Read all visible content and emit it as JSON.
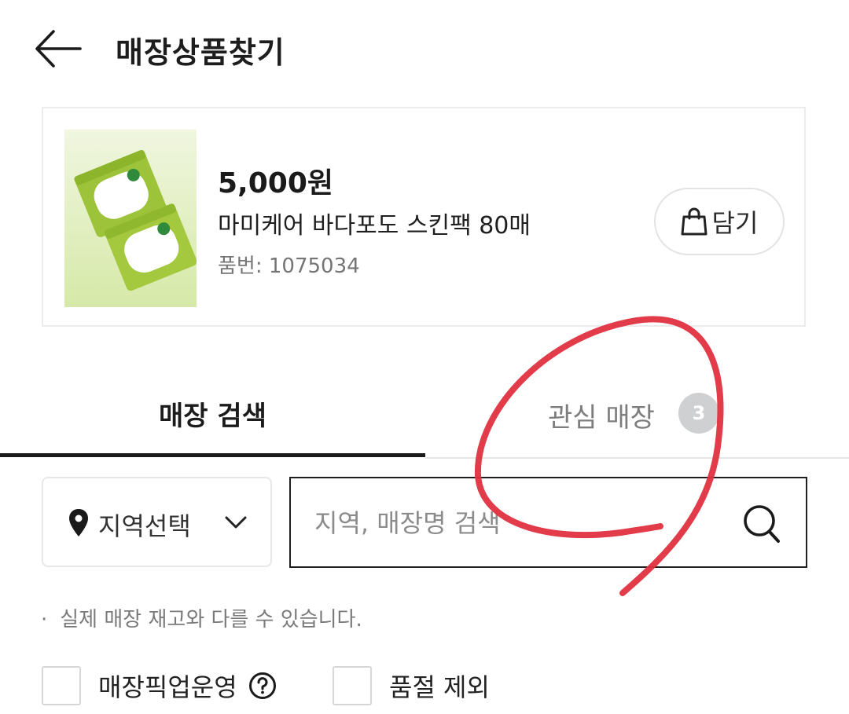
{
  "header": {
    "title": "매장상품찾기",
    "back_icon": "arrow-left-icon"
  },
  "product": {
    "price": "5,000원",
    "name": "마미케어 바다포도 스킨팩 80매",
    "item_number": "품번: 1075034",
    "cart_label": "담기",
    "cart_icon": "shopping-bag-icon",
    "image": "product-photo-green-wipes-packs"
  },
  "tabs": [
    {
      "label": "매장 검색",
      "active": true
    },
    {
      "label": "관심 매장",
      "active": false,
      "badge": "3"
    }
  ],
  "search": {
    "region_label": "지역선택",
    "region_icon": "location-pin-icon",
    "placeholder": "지역, 매장명 검색",
    "search_icon": "magnifier-icon"
  },
  "notice": {
    "bullet": "·",
    "text": "실제 매장 재고와 다를 수 있습니다."
  },
  "filters": [
    {
      "label": "매장픽업운영",
      "checked": false,
      "help_icon": "question-circle-icon"
    },
    {
      "label": "품절 제외",
      "checked": false
    }
  ],
  "colors": {
    "accent": "#1a1a1a",
    "badge_bg": "#cfd0d2",
    "annotation_red": "#e0303f",
    "product_bg": "#e9f2d4"
  }
}
